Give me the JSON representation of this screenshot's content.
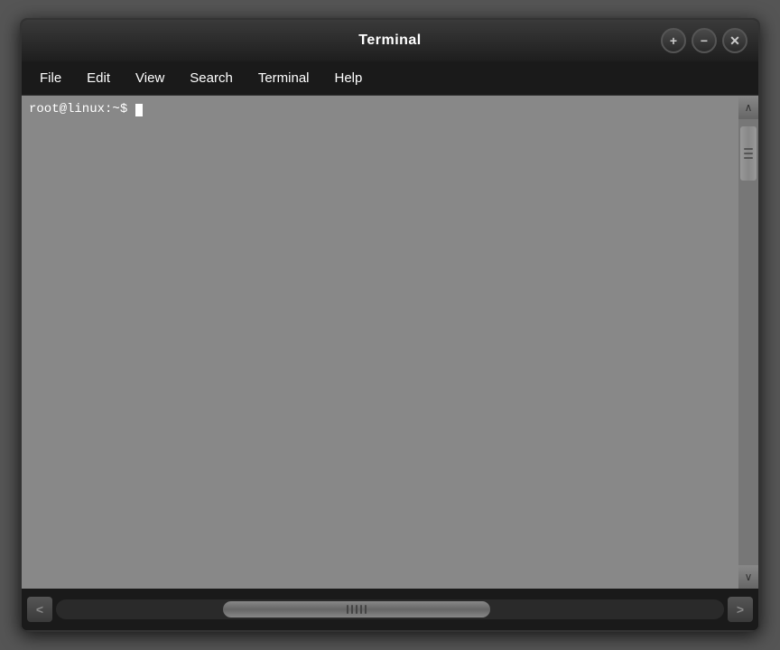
{
  "window": {
    "title": "Terminal",
    "controls": {
      "add": "+",
      "minimize": "−",
      "close": "✕"
    }
  },
  "menubar": {
    "items": [
      "File",
      "Edit",
      "View",
      "Search",
      "Terminal",
      "Help"
    ]
  },
  "terminal": {
    "prompt": "root@linux:~$"
  },
  "scrollbar": {
    "up_arrow": "∧",
    "down_arrow": "∨",
    "left_arrow": "<",
    "right_arrow": ">"
  }
}
